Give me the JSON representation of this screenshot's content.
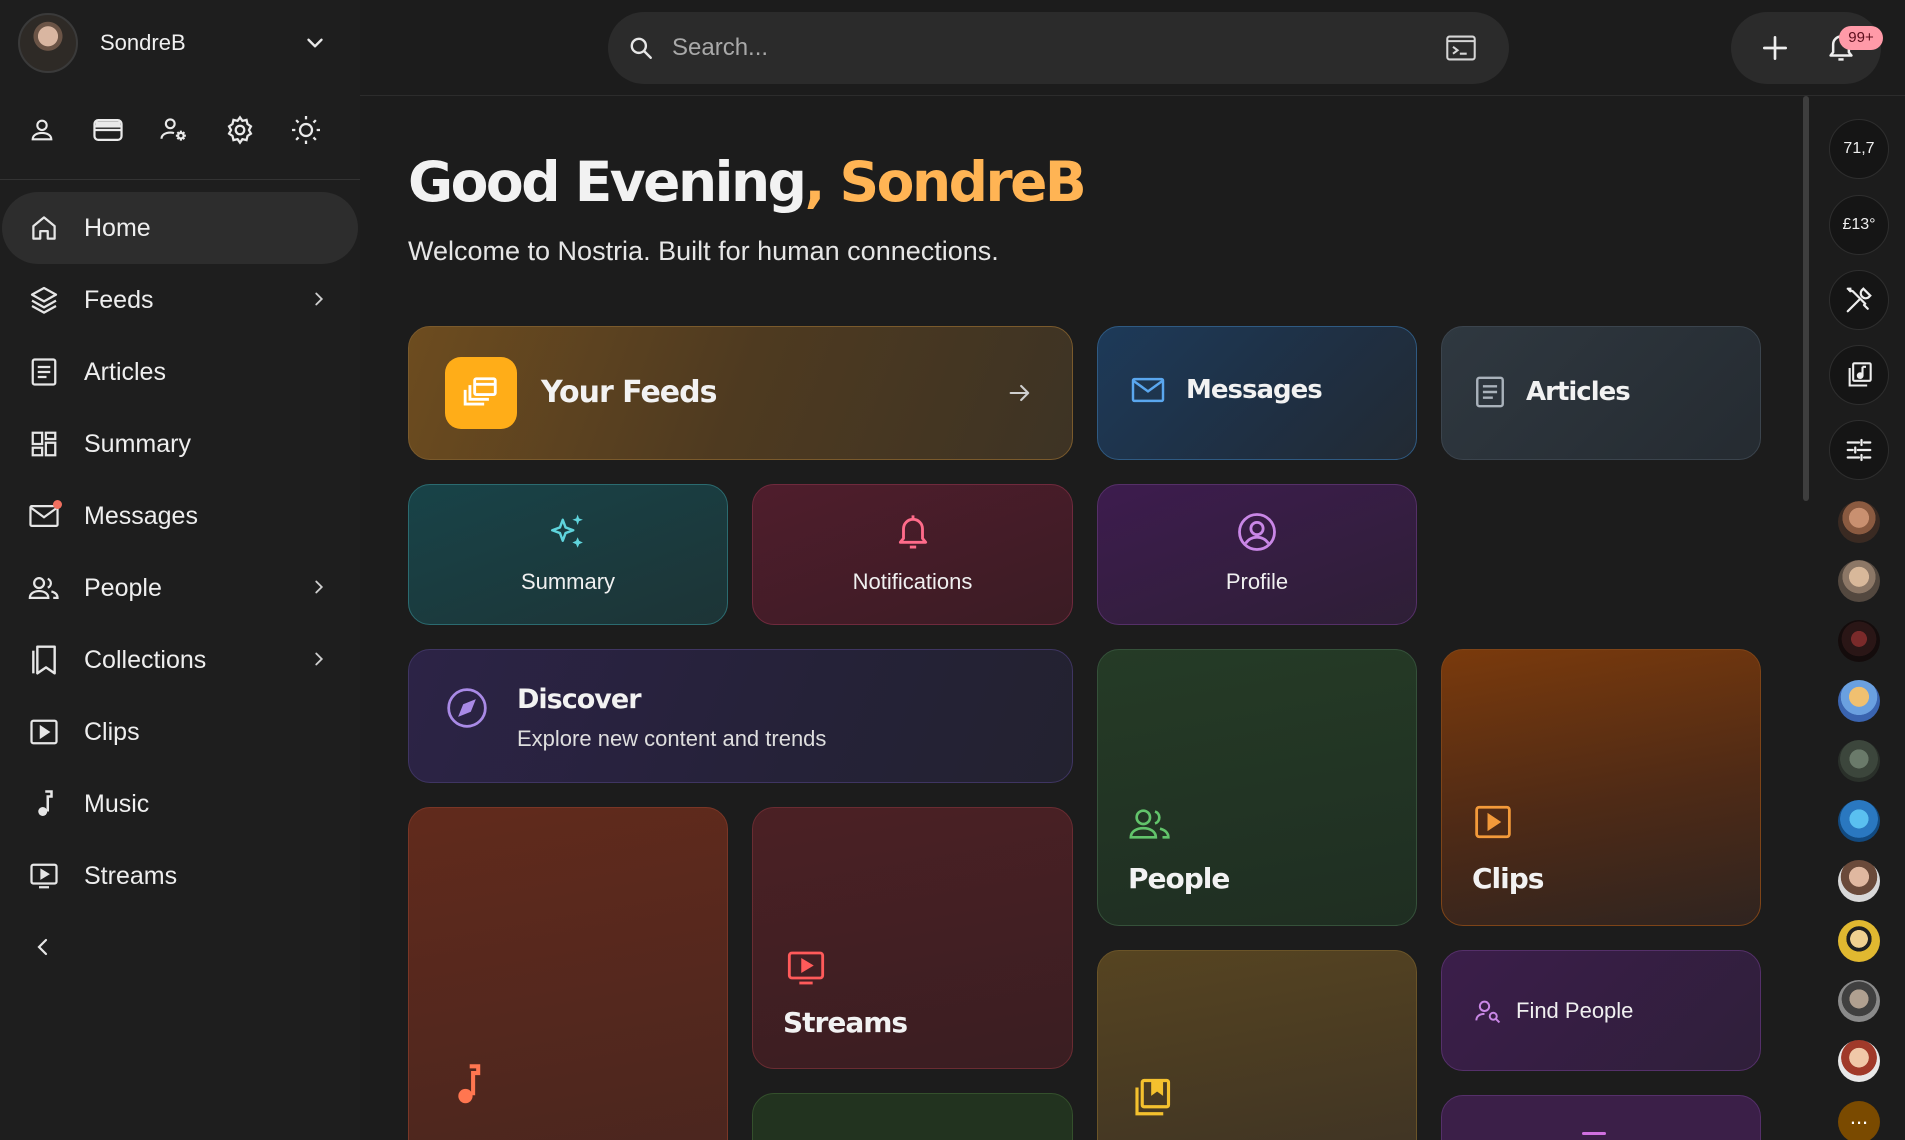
{
  "account": {
    "name": "SondreB",
    "avatar": "avatar"
  },
  "quick_icons": [
    "person-icon",
    "wallet-icon",
    "account-settings-icon",
    "gear-icon",
    "sun-icon"
  ],
  "nav": {
    "items": [
      {
        "label": "Home",
        "icon": "home-icon",
        "active": true
      },
      {
        "label": "Feeds",
        "icon": "layers-icon",
        "expandable": true
      },
      {
        "label": "Articles",
        "icon": "article-icon"
      },
      {
        "label": "Summary",
        "icon": "dashboard-icon"
      },
      {
        "label": "Messages",
        "icon": "mail-icon",
        "unread_dot": true
      },
      {
        "label": "People",
        "icon": "people-icon",
        "expandable": true
      },
      {
        "label": "Collections",
        "icon": "bookmarks-icon",
        "expandable": true
      },
      {
        "label": "Clips",
        "icon": "play-box-icon"
      },
      {
        "label": "Music",
        "icon": "music-note-icon"
      },
      {
        "label": "Streams",
        "icon": "live-tv-icon"
      }
    ]
  },
  "search": {
    "placeholder": "Search..."
  },
  "notifications": {
    "badge": "99+"
  },
  "greeting": {
    "prefix": "Good Evening",
    "separator": ", ",
    "name": "SondreB"
  },
  "subtitle": "Welcome to Nostria. Built for human connections.",
  "cards": {
    "your_feeds": "Your Feeds",
    "messages": "Messages",
    "articles": "Articles",
    "summary": "Summary",
    "notifications": "Notifications",
    "profile": "Profile",
    "discover_title": "Discover",
    "discover_desc": "Explore new content and trends",
    "people": "People",
    "clips": "Clips",
    "streams": "Streams",
    "find_people": "Find People"
  },
  "right_rail": {
    "widgets": [
      "71,7",
      "£13°",
      "tools-icon",
      "music-library-icon",
      "tune-icon"
    ],
    "more_label": "..."
  },
  "colors": {
    "accent": "#ffb454",
    "feeds_icon_bg": "#ffad18",
    "badge_bg": "#ff9aa8",
    "summary_icon": "#5fd4dc",
    "notifications_icon": "#ff6b8a",
    "profile_icon": "#c987e6",
    "people_icon": "#62c46b",
    "clips_icon": "#f39a3a",
    "streams_icon": "#ff5a5a",
    "music_icon": "#ff7650",
    "collections_icon": "#f4c12e"
  }
}
